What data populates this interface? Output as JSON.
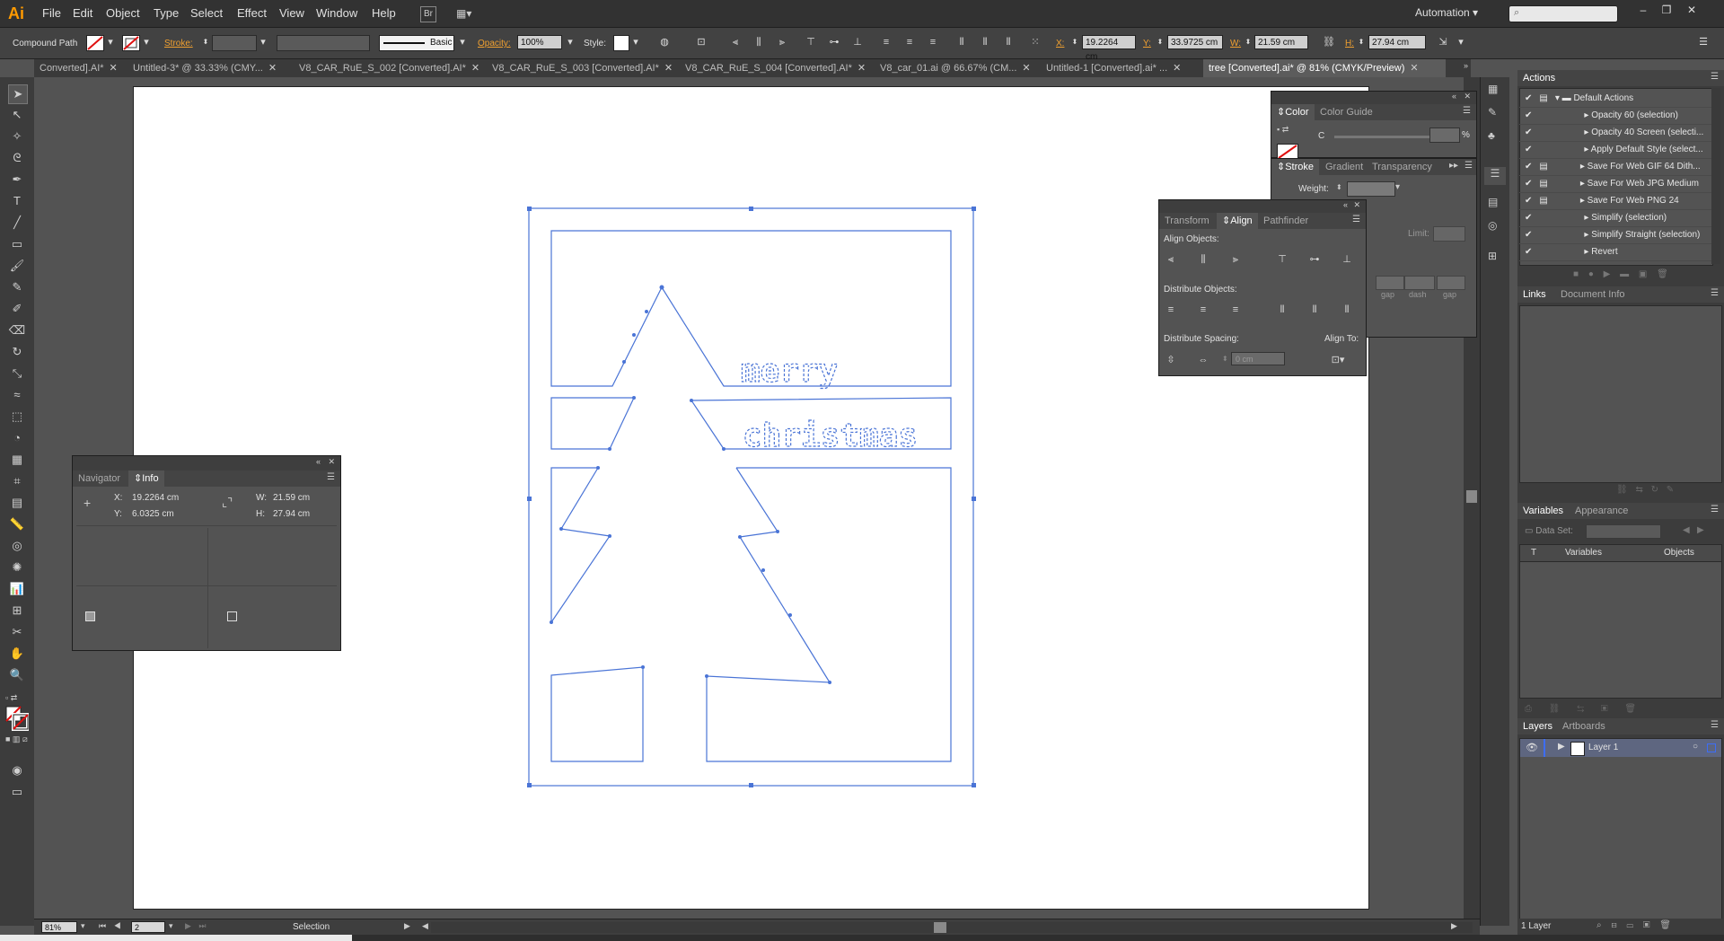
{
  "app": {
    "logo": "Ai",
    "accent": "#ff9a00"
  },
  "menu": [
    "File",
    "Edit",
    "Object",
    "Type",
    "Select",
    "Effect",
    "View",
    "Window",
    "Help"
  ],
  "workspace": "Automation",
  "control": {
    "selection_type": "Compound Path",
    "stroke_label": "Stroke:",
    "brush": "Basic",
    "opacity_label": "Opacity:",
    "opacity": "100%",
    "style_label": "Style:",
    "x_label": "X:",
    "x": "19.2264 cm",
    "y_label": "Y:",
    "y": "33.9725 cm",
    "w_label": "W:",
    "w": "21.59 cm",
    "h_label": "H:",
    "h": "27.94 cm"
  },
  "tabs": [
    {
      "label": "Converted].AI*"
    },
    {
      "label": "Untitled-3* @ 33.33% (CMY..."
    },
    {
      "label": "V8_CAR_RuE_S_002 [Converted].AI*"
    },
    {
      "label": "V8_CAR_RuE_S_003 [Converted].AI*"
    },
    {
      "label": "V8_CAR_RuE_S_004 [Converted].AI*"
    },
    {
      "label": "V8_car_01.ai @ 66.67% (CM..."
    },
    {
      "label": "Untitled-1 [Converted].ai* ..."
    },
    {
      "label": "tree [Converted].ai* @ 81% (CMYK/Preview)"
    }
  ],
  "artwork": {
    "text1": "merry",
    "text2": "christmas",
    "path_color": "#4a74d6"
  },
  "info_panel": {
    "tabs": [
      "Navigator",
      "Info"
    ],
    "x_label": "X:",
    "x": "19.2264 cm",
    "y_label": "Y:",
    "y": "6.0325 cm",
    "w_label": "W:",
    "w": "21.59 cm",
    "h_label": "H:",
    "h": "27.94 cm"
  },
  "color_panel": {
    "tabs": [
      "Color",
      "Color Guide"
    ],
    "channel": "C",
    "percent": "%"
  },
  "stroke_panel": {
    "tabs": [
      "Stroke",
      "Gradient",
      "Transparency"
    ],
    "weight_label": "Weight:",
    "limit_label": "Limit:",
    "gap_labels": [
      "gap",
      "dash",
      "gap"
    ]
  },
  "align_panel": {
    "tabs": [
      "Transform",
      "Align",
      "Pathfinder"
    ],
    "align_objects": "Align Objects:",
    "distribute_objects": "Distribute Objects:",
    "distribute_spacing": "Distribute Spacing:",
    "align_to": "Align To:",
    "spacing_value": "0 cm"
  },
  "actions_panel": {
    "title": "Actions",
    "items": [
      {
        "label": "Default Actions",
        "kind": "set"
      },
      {
        "label": "Opacity 60 (selection)"
      },
      {
        "label": "Opacity 40 Screen (selecti..."
      },
      {
        "label": "Apply Default Style (select..."
      },
      {
        "label": "Save For Web GIF 64 Dith..."
      },
      {
        "label": "Save For Web JPG Medium"
      },
      {
        "label": "Save For Web PNG 24"
      },
      {
        "label": "Simplify (selection)"
      },
      {
        "label": "Simplify Straight (selection)"
      },
      {
        "label": "Revert"
      }
    ]
  },
  "links_panel": {
    "tabs": [
      "Links",
      "Document Info"
    ]
  },
  "variables_panel": {
    "tabs": [
      "Variables",
      "Appearance"
    ],
    "data_set": "Data Set:",
    "col_t": "T",
    "col_vars": "Variables",
    "col_objs": "Objects"
  },
  "layers_panel": {
    "tabs": [
      "Layers",
      "Artboards"
    ],
    "layer_name": "Layer 1",
    "count": "1 Layer"
  },
  "status": {
    "zoom": "81%",
    "artboard": "2",
    "tool": "Selection"
  }
}
